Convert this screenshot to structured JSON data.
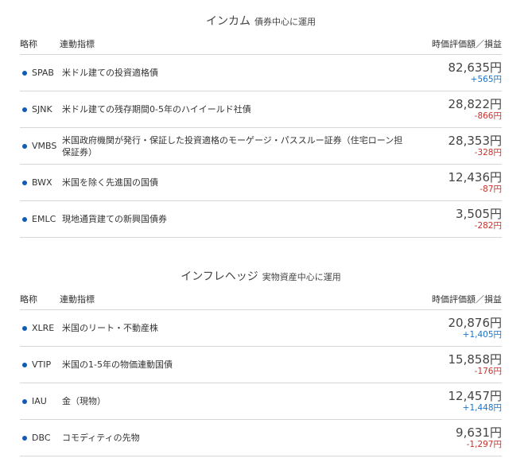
{
  "colors": {
    "dot": "#0f5bb5",
    "positive": "#1a73c9",
    "negative": "#c8312b"
  },
  "income": {
    "title": "インカム",
    "subtitle": "債券中心に運用",
    "headers": {
      "ticker": "略称",
      "index": "連動指標",
      "value": "時価評価額／損益"
    },
    "rows": [
      {
        "ticker": "SPAB",
        "name": "米ドル建ての投資適格債",
        "value": "82,635円",
        "change": "+565円",
        "sign": "pos"
      },
      {
        "ticker": "SJNK",
        "name": "米ドル建ての残存期間0-5年のハイイールド社債",
        "value": "28,822円",
        "change": "-866円",
        "sign": "neg"
      },
      {
        "ticker": "VMBS",
        "name": "米国政府機関が発行・保証した投資適格のモーゲージ・パススルー証券（住宅ローン担保証券）",
        "value": "28,353円",
        "change": "-328円",
        "sign": "neg"
      },
      {
        "ticker": "BWX",
        "name": "米国を除く先進国の国債",
        "value": "12,436円",
        "change": "-87円",
        "sign": "neg"
      },
      {
        "ticker": "EMLC",
        "name": "現地通貨建ての新興国債券",
        "value": "3,505円",
        "change": "-282円",
        "sign": "neg"
      }
    ]
  },
  "inflation": {
    "title": "インフレヘッジ",
    "subtitle": "実物資産中心に運用",
    "headers": {
      "ticker": "略称",
      "index": "連動指標",
      "value": "時価評価額／損益"
    },
    "rows": [
      {
        "ticker": "XLRE",
        "name": "米国のリート・不動産株",
        "value": "20,876円",
        "change": "+1,405円",
        "sign": "pos"
      },
      {
        "ticker": "VTIP",
        "name": "米国の1-5年の物価連動国債",
        "value": "15,858円",
        "change": "-176円",
        "sign": "neg"
      },
      {
        "ticker": "IAU",
        "name": "金（現物）",
        "value": "12,457円",
        "change": "+1,448円",
        "sign": "pos"
      },
      {
        "ticker": "DBC",
        "name": "コモディティの先物",
        "value": "9,631円",
        "change": "-1,297円",
        "sign": "neg"
      }
    ]
  }
}
